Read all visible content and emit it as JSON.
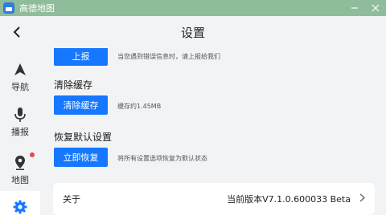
{
  "window": {
    "title": "高德地图",
    "minimize_icon": "minimize-icon",
    "close_icon": "close-icon"
  },
  "header": {
    "title": "设置",
    "back_icon": "chevron-left-icon"
  },
  "sidebar": {
    "items": [
      {
        "label": "导航",
        "icon": "navigation-arrow-icon",
        "badge": false
      },
      {
        "label": "播报",
        "icon": "microphone-icon",
        "badge": false
      },
      {
        "label": "地图",
        "icon": "map-pin-icon",
        "badge": true
      },
      {
        "label": "",
        "icon": "gear-icon",
        "active": true
      }
    ]
  },
  "sections": {
    "report": {
      "button": "上报",
      "hint": "当您遇到错误信息时，请上报给我们"
    },
    "cache": {
      "title": "清除缓存",
      "button": "清除缓存",
      "hint": "缓存约1.45MB"
    },
    "reset": {
      "title": "恢复默认设置",
      "button": "立即恢复",
      "hint": "将所有设置选项恢复为默认状态"
    },
    "about": {
      "label": "关于",
      "version": "当前版本V7.1.0.600033 Beta",
      "chevron_icon": "chevron-right-icon"
    }
  },
  "colors": {
    "titlebar": "#8fbc9a",
    "accent": "#1677ff",
    "background": "#f2f3f5",
    "badge": "#e8484a"
  }
}
